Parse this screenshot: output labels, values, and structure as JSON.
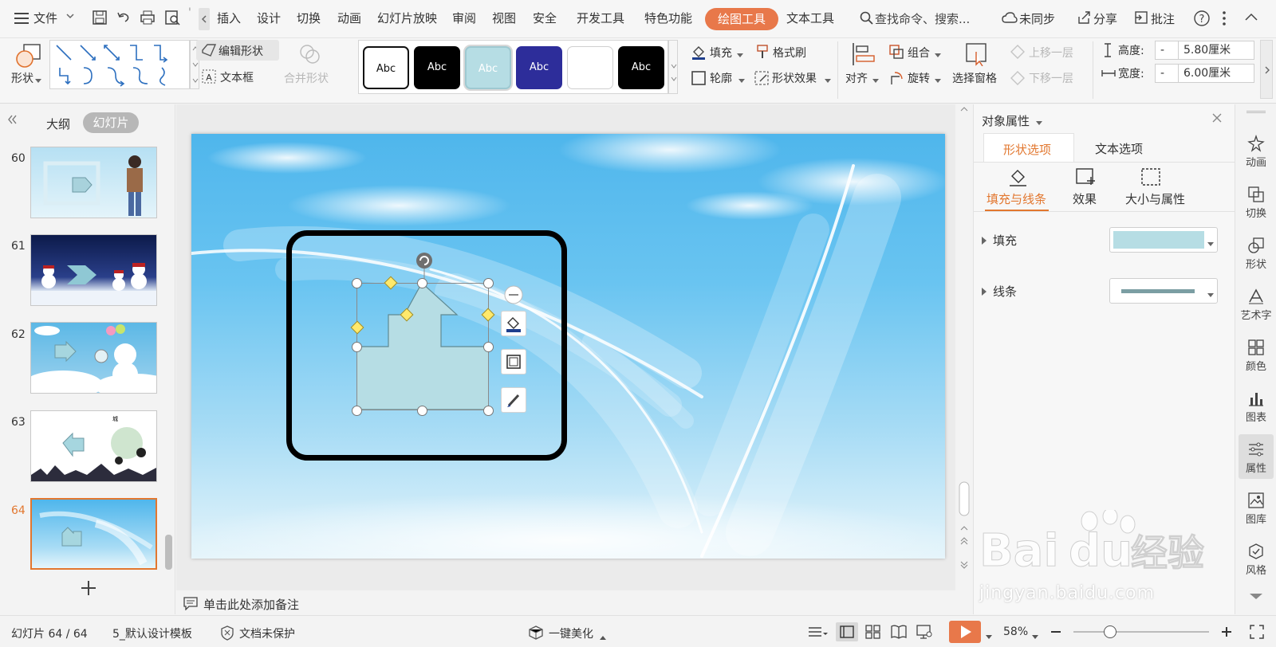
{
  "topbar": {
    "menu_label": "文件",
    "tabs": [
      "插入",
      "设计",
      "切换",
      "动画",
      "幻灯片放映",
      "审阅",
      "视图",
      "安全",
      "开发工具",
      "特色功能",
      "绘图工具",
      "文本工具"
    ],
    "search_placeholder": "查找命令、搜索...",
    "sync_label": "未同步",
    "share_label": "分享",
    "comment_label": "批注"
  },
  "ribbon": {
    "shape_label": "形状",
    "edit_shape_label": "编辑形状",
    "textbox_label": "文本框",
    "merge_shape_label": "合并形状",
    "style_samples": [
      "Abc",
      "Abc",
      "Abc",
      "Abc",
      "",
      "Abc"
    ],
    "fill_label": "填充",
    "format_painter_label": "格式刷",
    "outline_label": "轮廓",
    "shape_effects_label": "形状效果",
    "align_label": "对齐",
    "group_label": "组合",
    "rotate_label": "旋转",
    "selection_pane_label": "选择窗格",
    "bring_forward_label": "上移一层",
    "send_backward_label": "下移一层",
    "height_label": "高度:",
    "height_value": "5.80厘米",
    "width_label": "宽度:",
    "width_value": "6.00厘米",
    "minus": "-"
  },
  "leftpane": {
    "outline_tab": "大纲",
    "slides_tab": "幻灯片",
    "slide_numbers": [
      "60",
      "61",
      "62",
      "63",
      "64"
    ],
    "active_slide": "64"
  },
  "rightpanel": {
    "title": "对象属性",
    "tabs": [
      "形状选项",
      "文本选项"
    ],
    "subtabs": [
      "填充与线条",
      "效果",
      "大小与属性"
    ],
    "fill_label": "填充",
    "line_label": "线条",
    "fill_color": "#b6dde4",
    "line_color": "#7b9ea3"
  },
  "sidebar": {
    "items": [
      "动画",
      "切换",
      "形状",
      "艺术字",
      "颜色",
      "图表",
      "属性",
      "图库",
      "风格"
    ]
  },
  "notes": {
    "placeholder": "单击此处添加备注"
  },
  "status": {
    "slide_info": "幻灯片 64 / 64",
    "template": "5_默认设计模板",
    "protection": "文档未保护",
    "beautify": "一键美化",
    "zoom": "58%"
  },
  "watermark": {
    "text": "jingyan.baidu.com"
  },
  "colors": {
    "accent": "#e8784a",
    "shape_fill": "#b6dde4",
    "selected_border": "#e2772f"
  }
}
